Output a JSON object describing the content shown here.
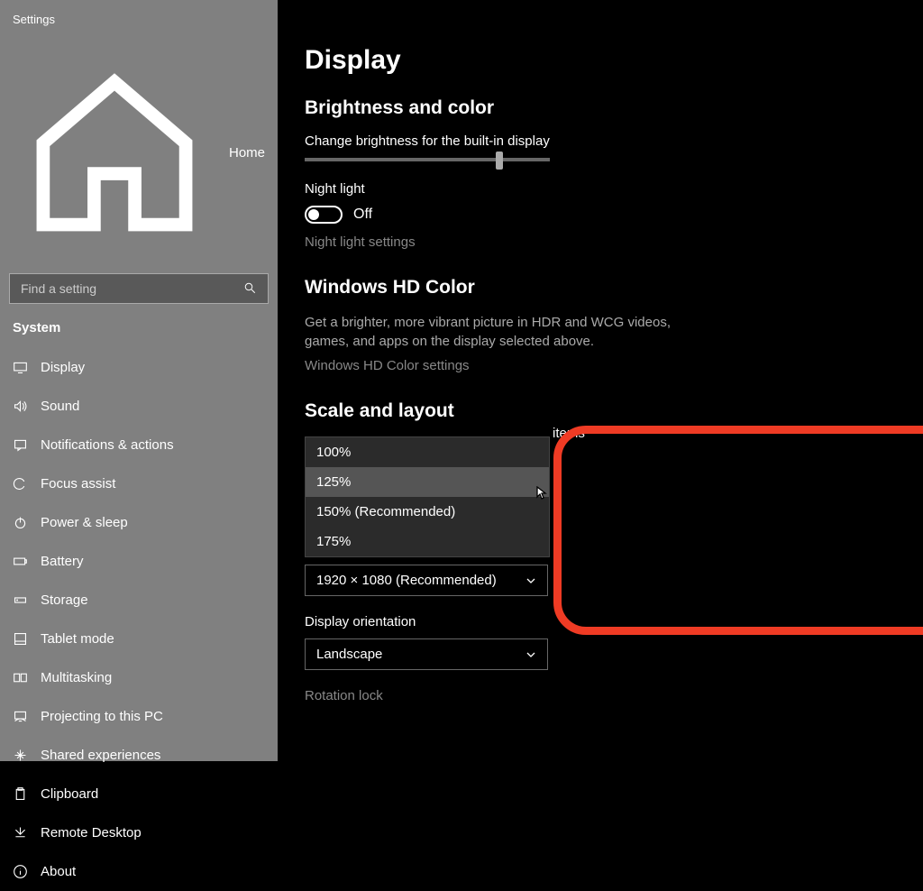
{
  "app_title": "Settings",
  "home_label": "Home",
  "search_placeholder": "Find a setting",
  "category": "System",
  "nav": [
    {
      "label": "Display"
    },
    {
      "label": "Sound"
    },
    {
      "label": "Notifications & actions"
    },
    {
      "label": "Focus assist"
    },
    {
      "label": "Power & sleep"
    },
    {
      "label": "Battery"
    },
    {
      "label": "Storage"
    },
    {
      "label": "Tablet mode"
    },
    {
      "label": "Multitasking"
    },
    {
      "label": "Projecting to this PC"
    },
    {
      "label": "Shared experiences"
    },
    {
      "label": "Clipboard"
    },
    {
      "label": "Remote Desktop"
    },
    {
      "label": "About"
    }
  ],
  "page_title": "Display",
  "brightness": {
    "heading": "Brightness and color",
    "label": "Change brightness for the built-in display",
    "night_light_label": "Night light",
    "night_light_state": "Off",
    "settings_link": "Night light settings"
  },
  "hd_color": {
    "heading": "Windows HD Color",
    "desc": "Get a brighter, more vibrant picture in HDR and WCG videos, games, and apps on the display selected above.",
    "link": "Windows HD Color settings"
  },
  "scale": {
    "heading": "Scale and layout",
    "items_suffix": "items",
    "options": [
      "100%",
      "125%",
      "150% (Recommended)",
      "175%"
    ],
    "hovered_index": 1,
    "resolution_label_partial": "1920 × 1080 (Recommended)",
    "orientation_label": "Display orientation",
    "orientation_value": "Landscape",
    "rotation_lock_label": "Rotation lock"
  }
}
